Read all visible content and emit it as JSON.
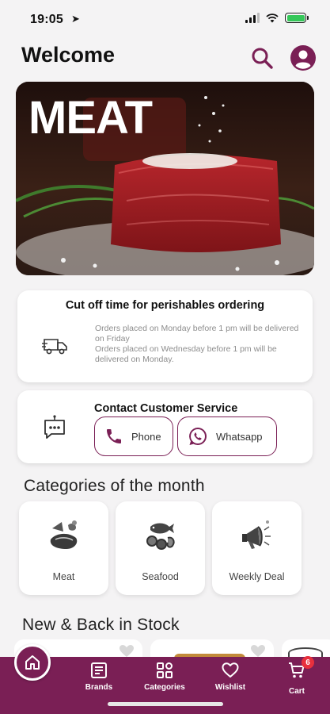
{
  "status_bar": {
    "time": "19:05",
    "location_arrow": "➤"
  },
  "header": {
    "title": "Welcome",
    "search_icon": "search-icon",
    "account_icon": "account-icon"
  },
  "hero": {
    "title": "MEAT"
  },
  "cutoff": {
    "title": "Cut off time for perishables ordering",
    "lines": [
      "Orders placed on Monday before 1 pm will be delivered on Friday",
      "Orders placed on Wednesday before 1 pm will be delivered on Monday."
    ]
  },
  "contact": {
    "title": "Contact Customer Service",
    "phone_label": "Phone",
    "whatsapp_label": "Whatsapp"
  },
  "categories": {
    "title": "Categories of the month",
    "items": [
      {
        "label": "Meat",
        "icon": "meat-icon"
      },
      {
        "label": "Seafood",
        "icon": "seafood-icon"
      },
      {
        "label": "Weekly Deal",
        "icon": "megaphone-icon"
      }
    ]
  },
  "new_in_stock": {
    "title": "New & Back in Stock"
  },
  "bottom_nav": {
    "items": [
      {
        "label": "Brands",
        "icon": "brands-icon"
      },
      {
        "label": "Categories",
        "icon": "categories-icon"
      },
      {
        "label": "Wishlist",
        "icon": "heart-icon"
      },
      {
        "label": "Cart",
        "icon": "cart-icon"
      }
    ],
    "cart_count": "6"
  },
  "colors": {
    "brand": "#7a1f55",
    "badge": "#e8303d",
    "muted_text": "#8d8d8d"
  }
}
